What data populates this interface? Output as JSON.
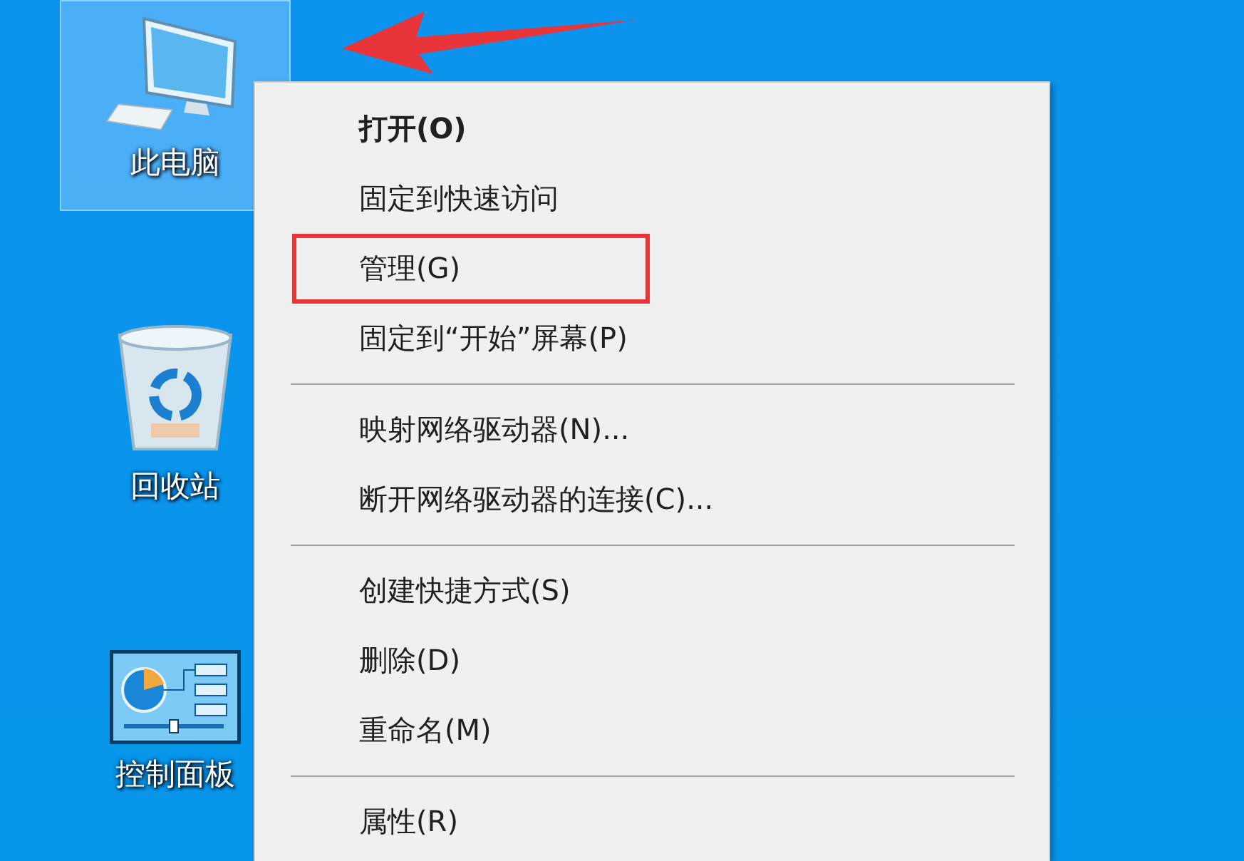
{
  "desktop": {
    "icons": [
      {
        "kind": "computer",
        "label": "此电脑",
        "selected": true
      },
      {
        "kind": "recycle",
        "label": "回收站",
        "selected": false
      },
      {
        "kind": "panel",
        "label": "控制面板",
        "selected": false
      }
    ]
  },
  "annotation": {
    "arrow": true
  },
  "context_menu": {
    "groups": [
      {
        "items": [
          {
            "label": "打开(O)",
            "bold": true,
            "highlighted": false
          },
          {
            "label": "固定到快速访问",
            "bold": false,
            "highlighted": false
          },
          {
            "label": "管理(G)",
            "bold": false,
            "highlighted": true
          },
          {
            "label": "固定到“开始”屏幕(P)",
            "bold": false,
            "highlighted": false
          }
        ]
      },
      {
        "items": [
          {
            "label": "映射网络驱动器(N)...",
            "bold": false,
            "highlighted": false
          },
          {
            "label": "断开网络驱动器的连接(C)...",
            "bold": false,
            "highlighted": false
          }
        ]
      },
      {
        "items": [
          {
            "label": "创建快捷方式(S)",
            "bold": false,
            "highlighted": false
          },
          {
            "label": "删除(D)",
            "bold": false,
            "highlighted": false
          },
          {
            "label": "重命名(M)",
            "bold": false,
            "highlighted": false
          }
        ]
      },
      {
        "items": [
          {
            "label": "属性(R)",
            "bold": false,
            "highlighted": false
          }
        ]
      }
    ]
  }
}
